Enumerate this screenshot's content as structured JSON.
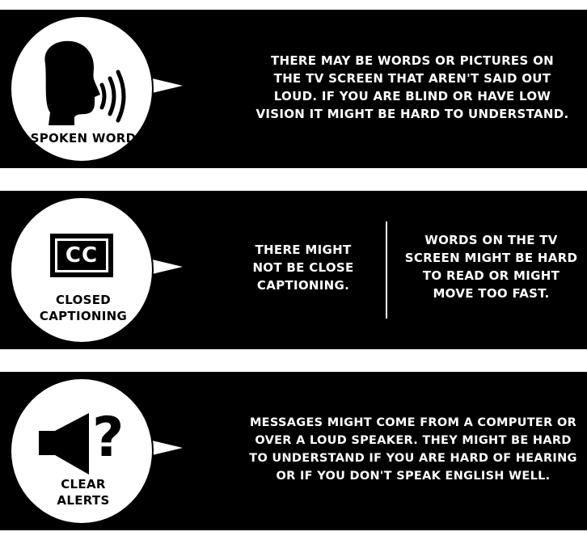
{
  "panels": [
    {
      "label": "SPOKEN WORD",
      "icon": "speaking-head-icon",
      "text": "THERE MAY BE WORDS OR PICTURES ON\nTHE TV SCREEN THAT AREN'T SAID OUT\nLOUD. IF YOU ARE BLIND OR HAVE LOW\nVISION IT MIGHT BE HARD TO UNDERSTAND."
    },
    {
      "label": "CLOSED\nCAPTIONING",
      "icon": "closed-caption-icon",
      "icon_text": "CC",
      "text_left": "THERE MIGHT\nNOT BE CLOSE\nCAPTIONING.",
      "text_right": "WORDS ON THE TV\nSCREEN MIGHT BE HARD\nTO READ OR MIGHT\nMOVE TOO FAST."
    },
    {
      "label": "CLEAR\nALERTS",
      "icon": "speaker-question-icon",
      "icon_text": "?",
      "text": "MESSAGES MIGHT COME FROM A COMPUTER OR\nOVER A LOUD SPEAKER. THEY MIGHT BE HARD\nTO UNDERSTAND IF YOU ARE HARD OF HEARING\nOR IF YOU DON'T SPEAK ENGLISH WELL."
    }
  ]
}
